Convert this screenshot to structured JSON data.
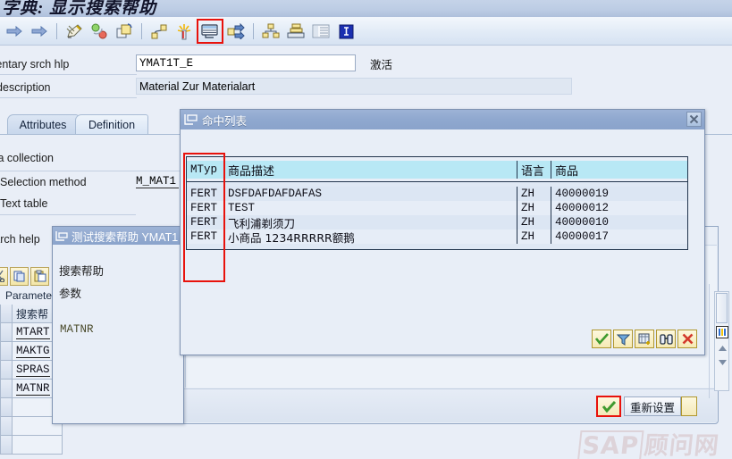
{
  "window": {
    "title": "字典: 显示搜索帮助"
  },
  "toolbar": {
    "items": [
      {
        "name": "back-arrow-icon",
        "label": "Back"
      },
      {
        "name": "forward-arrow-icon",
        "label": "Forward"
      },
      {
        "name": "display-change-pencil-icon",
        "label": "Display/Change"
      },
      {
        "name": "activate-icon",
        "label": "Activate"
      },
      {
        "name": "copy-object-icon",
        "label": "Copy"
      },
      {
        "name": "where-used-icon",
        "label": "Where-used list"
      },
      {
        "name": "check-sparkle-icon",
        "label": "Check"
      },
      {
        "name": "test-search-help-icon",
        "label": "Test"
      },
      {
        "name": "expand-arrows-icon",
        "label": "Expand"
      },
      {
        "name": "hierarchy-icon",
        "label": "Hierarchy"
      },
      {
        "name": "stack-icon",
        "label": "Stack"
      },
      {
        "name": "list-icon",
        "label": "List"
      },
      {
        "name": "info-icon",
        "label": "Information"
      }
    ],
    "highlighted_index": 7
  },
  "form": {
    "field1_label": "ementary srch hlp",
    "field1_value": "YMAT1T_E",
    "field1_status": "激活",
    "field2_label": "ort description",
    "field2_value": "Material Zur Materialart"
  },
  "tabs": [
    {
      "label": "Attributes",
      "active": false
    },
    {
      "label": "Definition",
      "active": true
    }
  ],
  "definition": {
    "section_label": "Data collection",
    "selection_method_label": "Selection method",
    "selection_method_value": "M_MAT1",
    "text_table_label": "Text table",
    "text_table_value": "",
    "search_help_label": "Search help"
  },
  "left_tools": [
    {
      "name": "cut-icon",
      "label": "Cut"
    },
    {
      "name": "copy-icon",
      "label": "Copy"
    },
    {
      "name": "paste-icon",
      "label": "Paste"
    }
  ],
  "parameters_table": {
    "title": "Paramete",
    "column_header": "搜索帮",
    "rows": [
      "MTART",
      "MAKTG",
      "SPRAS",
      "MATNR"
    ]
  },
  "hit_list_dialog": {
    "title": "命中列表",
    "title_icon": "dialog-window-icon",
    "close_icon": "close-icon",
    "columns": [
      {
        "key": "mtyp",
        "label": "MTyp"
      },
      {
        "key": "desc",
        "label": "商品描述"
      },
      {
        "key": "lang",
        "label": "语言"
      },
      {
        "key": "matnr",
        "label": "商品"
      }
    ],
    "rows": [
      {
        "mtyp": "FERT",
        "desc": "DSFDAFDAFDAFAS",
        "lang": "ZH",
        "matnr": "40000019"
      },
      {
        "mtyp": "FERT",
        "desc": "TEST",
        "lang": "ZH",
        "matnr": "40000012"
      },
      {
        "mtyp": "FERT",
        "desc": "飞利浦剃须刀",
        "lang": "ZH",
        "matnr": "40000010"
      },
      {
        "mtyp": "FERT",
        "desc": "小商品 1234RRRRR额鹅",
        "lang": "ZH",
        "matnr": "40000017"
      }
    ],
    "buttons": [
      {
        "name": "confirm-check-button",
        "label": "Copy"
      },
      {
        "name": "filter-funnel-button",
        "label": "Set filter"
      },
      {
        "name": "personalize-button",
        "label": "Personal list"
      },
      {
        "name": "find-binoculars-button",
        "label": "Find"
      },
      {
        "name": "cancel-x-button",
        "label": "Cancel"
      }
    ]
  },
  "test_dialog": {
    "title": "测试搜索帮助 YMAT1",
    "title_icon": "dialog-window-icon",
    "search_help_label": "搜索帮助",
    "parameters_label": "参数",
    "field_name": "MATNR",
    "field_value": "",
    "buttons": [
      {
        "name": "ok-check-button",
        "label": ""
      },
      {
        "name": "reset-button",
        "label": "重新设置"
      },
      {
        "name": "blank-button",
        "label": ""
      }
    ]
  },
  "scrollbar": {
    "icon_name": "color-bars-icon",
    "up_arrow_name": "scroll-up-icon",
    "down_arrow_name": "scroll-down-icon"
  },
  "watermark": {
    "brand": "SAP",
    "text": "顾问网"
  },
  "colors": {
    "highlight": "#e8120c",
    "title_bar": "#8fa8cf",
    "page_bg": "#e9eef7",
    "table_header": "#b8e8f5",
    "button_yellow": "#f6eab4"
  }
}
